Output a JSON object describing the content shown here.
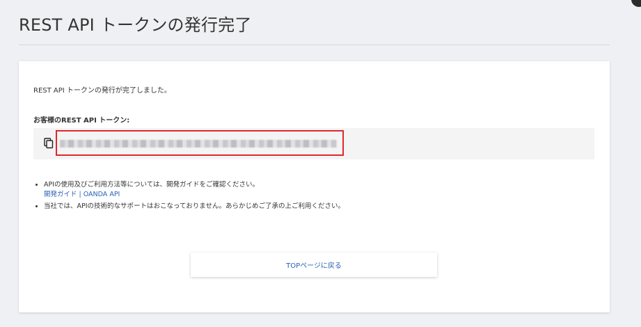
{
  "page": {
    "title": "REST API トークンの発行完了"
  },
  "card": {
    "message": "REST API トークンの発行が完了しました。",
    "token_heading": "お客様のREST API トークン:",
    "token_value": "xxxx-xxxxxxxx-xxxxxxxxxxxxxxxx-xxxxxxxxxxxx"
  },
  "notes": {
    "item1_text": "APIの使用及びご利用方法等については、開発ガイドをご確認ください。",
    "item1_link": "開発ガイド | OANDA API",
    "item2_text": "当社では、APIの技術的なサポートはおこなっておりません。あらかじめご了承の上ご利用ください。"
  },
  "buttons": {
    "top_label": "TOPページに戻る"
  },
  "icons": {
    "copy": "copy-icon"
  },
  "colors": {
    "link": "#2a62b7",
    "highlight_border": "#e2262b",
    "background": "#eef0f3"
  }
}
